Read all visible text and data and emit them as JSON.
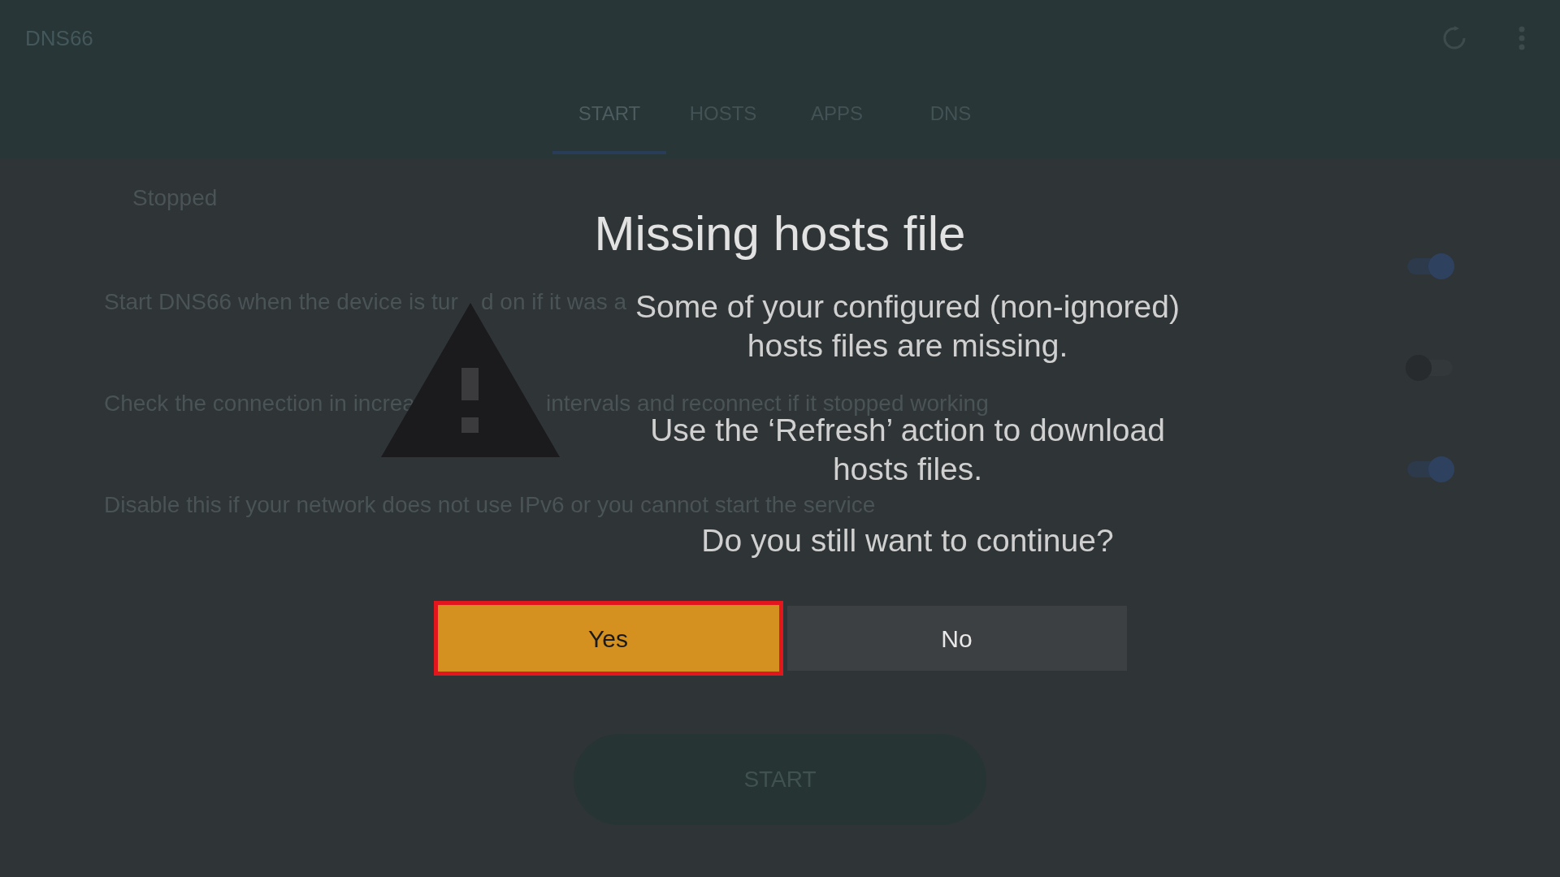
{
  "app_bar": {
    "title": "DNS66"
  },
  "tabs": [
    {
      "label": "START",
      "selected": true
    },
    {
      "label": "HOSTS",
      "selected": false
    },
    {
      "label": "APPS",
      "selected": false
    },
    {
      "label": "DNS",
      "selected": false
    }
  ],
  "status": "Stopped",
  "settings": [
    {
      "description_parts": [
        "Start DNS66 when the device is tur",
        "d on if it was a"
      ],
      "on": true
    },
    {
      "description_parts": [
        "Check the connection in increa",
        "intervals and reconnect if it stopped working"
      ],
      "on": false
    },
    {
      "description_parts": [
        "Disable this if your network does not use IPv6 or you cannot start the service"
      ],
      "on": true
    }
  ],
  "start_button": {
    "label": "START"
  },
  "dialog": {
    "title": "Missing hosts file",
    "paragraphs": [
      "Some of your configured (non-ignored) hosts files are missing.",
      "Use the ‘Refresh’ action to download hosts files.",
      "Do you still want to continue?"
    ],
    "buttons": [
      {
        "label": "Yes",
        "focused": true
      },
      {
        "label": "No",
        "focused": false
      }
    ]
  }
}
